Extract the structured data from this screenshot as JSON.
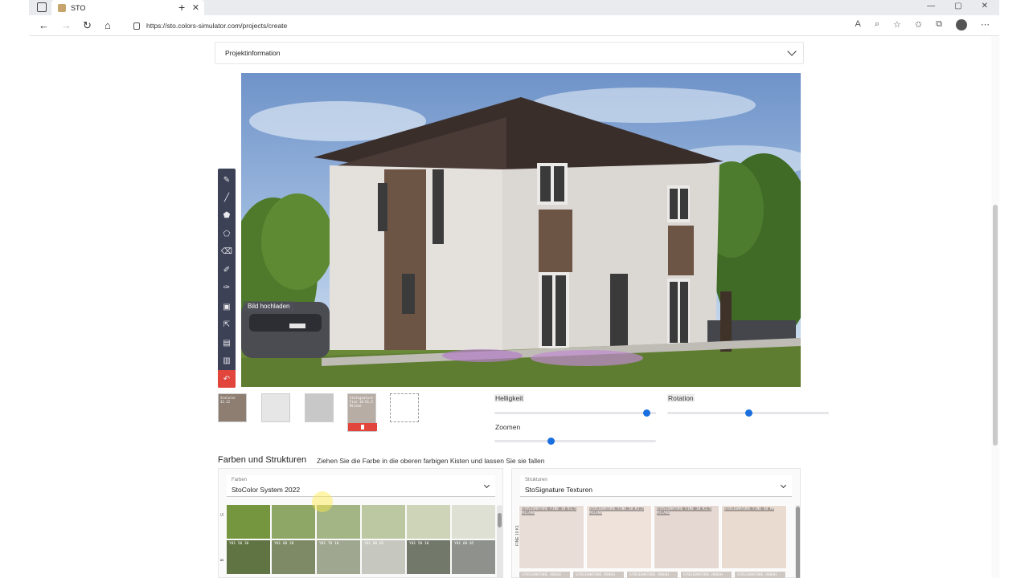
{
  "browser": {
    "tab_title": "STO",
    "url": "https://sto.colors-simulator.com/projects/create",
    "new_tab": "+",
    "close_tab": "✕",
    "window_controls": [
      "—",
      "▢",
      "✕"
    ]
  },
  "page": {
    "accordion_title": "Projektinformation",
    "tooltip": "Bild hochladen",
    "sliders": {
      "brightness": {
        "label": "Helligkeit",
        "value": 0.94
      },
      "rotation": {
        "label": "Rotation",
        "value": 0.5
      },
      "zoom": {
        "label": "Zoomen",
        "value": 0.35
      }
    },
    "swatch_slots": [
      {
        "code": "StoColor 32.12",
        "color": "#8d7e71"
      },
      {
        "code": "",
        "color": "#e6e6e6"
      },
      {
        "code": "",
        "color": "#c8c8c8"
      },
      {
        "code": "StoSignature Fine 10 K1,5 Milano",
        "color": "#b7ada5"
      },
      {
        "code": "",
        "color": "#ffffff"
      }
    ],
    "section_title": "Farben und Strukturen",
    "section_hint": "Ziehen Sie die Farbe in die oberen farbigen Kisten und lassen Sie sie fallen",
    "colors_select": {
      "label": "Farben",
      "value": "StoColor System 2022"
    },
    "structures_select": {
      "label": "Strukturen",
      "value": "StoSignature Texturen"
    },
    "color_rows": [
      {
        "group_label": "G",
        "cells": [
          {
            "code": "",
            "color": "#75953e"
          },
          {
            "code": "",
            "color": "#8fa766"
          },
          {
            "code": "",
            "color": "#a3b584"
          },
          {
            "code": "",
            "color": "#bcc8a2"
          },
          {
            "code": "",
            "color": "#cdd4b8"
          },
          {
            "code": "",
            "color": "#dde0d3"
          }
        ]
      },
      {
        "group_label": "B",
        "cells": [
          {
            "code": "Y01 50 30",
            "color": "#5f7343"
          },
          {
            "code": "Y01 60 20",
            "color": "#7d8a65"
          },
          {
            "code": "Y01 70 10",
            "color": "#a0a790"
          },
          {
            "code": "Y01 80 05",
            "color": "#c6c8bf"
          },
          {
            "code": "Y01 50 10",
            "color": "#72786a"
          },
          {
            "code": "Y01 60 05",
            "color": "#8e918c"
          }
        ]
      }
    ],
    "texture_row_label": "FINE 10 K1",
    "textures": [
      {
        "code": "STOSIGNATURE FINE 10 K1,5 MILANO",
        "color": "#e9ddd8"
      },
      {
        "code": "STOSIGNATURE FINE 20 K1,5 MILANO",
        "color": "#eee2db"
      },
      {
        "code": "STOSIGNATURE FINE 10 K1,5 MILANO",
        "color": "#e5d8d2"
      },
      {
        "code": "STOSIGNATURE FINE 40 MP",
        "color": "#eadbd0"
      }
    ],
    "textures_row2": [
      "STOSIGNATURE ROUGH",
      "STOSIGNATURE ROUGH",
      "STOSIGNATURE ROUGH",
      "STOSIGNATURE ROUGH",
      "STOSIGNATURE ROUGH"
    ]
  }
}
